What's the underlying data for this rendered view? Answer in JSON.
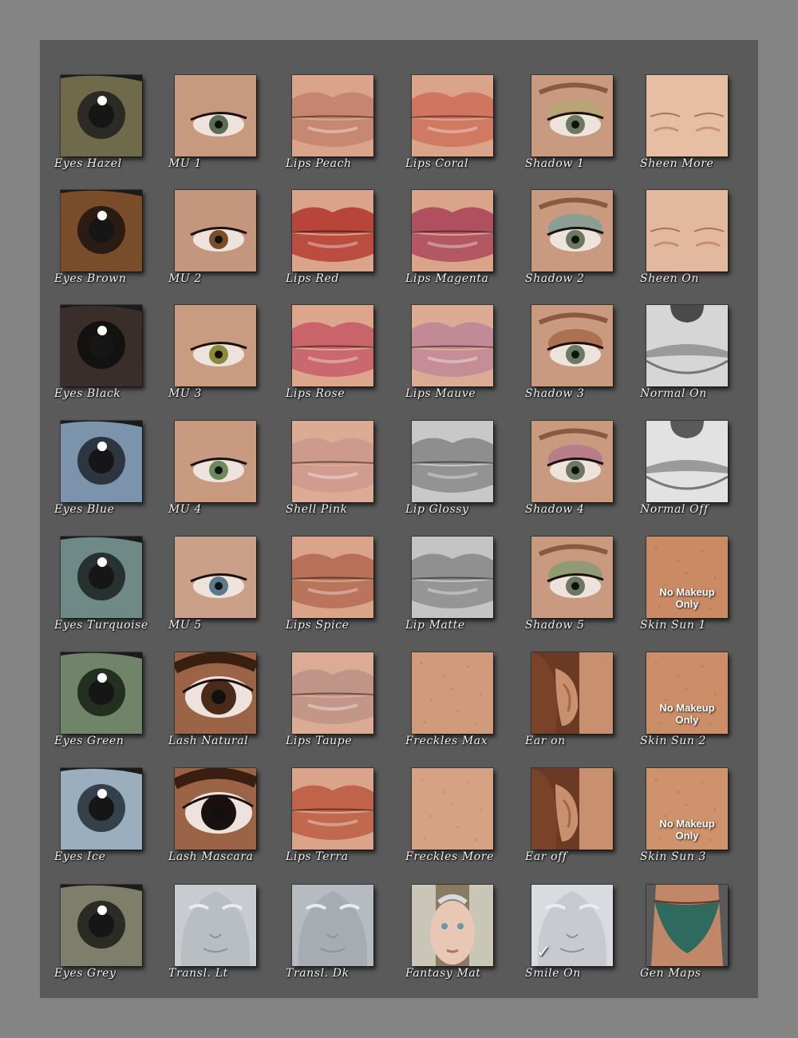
{
  "columns": [
    {
      "id": "eyes",
      "items": [
        {
          "label": "Eyes Hazel",
          "swatch": "eye-hazel",
          "colors": [
            "#6e6a4a",
            "#2b2a25"
          ]
        },
        {
          "label": "Eyes Brown",
          "swatch": "eye-brown",
          "colors": [
            "#7a4e2a",
            "#2a1c12"
          ]
        },
        {
          "label": "Eyes Black",
          "swatch": "eye-black",
          "colors": [
            "#3a2f2a",
            "#141211"
          ]
        },
        {
          "label": "Eyes Blue",
          "swatch": "eye-blue",
          "colors": [
            "#7b93ab",
            "#2c3540"
          ]
        },
        {
          "label": "Eyes Turquoise",
          "swatch": "eye-turquoise",
          "colors": [
            "#6f8a86",
            "#263130"
          ]
        },
        {
          "label": "Eyes Green",
          "swatch": "eye-green",
          "colors": [
            "#6f8468",
            "#24301f"
          ]
        },
        {
          "label": "Eyes Ice",
          "swatch": "eye-ice",
          "colors": [
            "#9aaebd",
            "#34404a"
          ]
        },
        {
          "label": "Eyes Grey",
          "swatch": "eye-grey",
          "colors": [
            "#7e7e6a",
            "#2b2b26"
          ]
        }
      ]
    },
    {
      "id": "makeup",
      "items": [
        {
          "label": "MU 1",
          "swatch": "makeup-eye",
          "colors": [
            "#c79a80",
            "#5a6e55"
          ]
        },
        {
          "label": "MU 2",
          "swatch": "makeup-eye",
          "colors": [
            "#c4967d",
            "#7a4e2a"
          ]
        },
        {
          "label": "MU 3",
          "swatch": "makeup-eye",
          "colors": [
            "#c89c80",
            "#8c8a3a"
          ]
        },
        {
          "label": "MU 4",
          "swatch": "makeup-eye",
          "colors": [
            "#c89a80",
            "#6e8a5a"
          ]
        },
        {
          "label": "MU 5",
          "swatch": "makeup-eye",
          "colors": [
            "#caa088",
            "#5c7a8a"
          ]
        },
        {
          "label": "Lash Natural",
          "swatch": "lash-eye",
          "colors": [
            "#8a5a3c",
            "#4a2a18"
          ]
        },
        {
          "label": "Lash Mascara",
          "swatch": "lash-eye",
          "colors": [
            "#8c5c40",
            "#1a1010"
          ]
        },
        {
          "label": "Transl. Lt",
          "swatch": "face-grey",
          "colors": [
            "#c8ccd0",
            "#9ea3a8"
          ]
        }
      ]
    },
    {
      "id": "lips-a",
      "items": [
        {
          "label": "Lips Peach",
          "swatch": "lips",
          "colors": [
            "#d9a48a",
            "#c58570"
          ]
        },
        {
          "label": "Lips Red",
          "swatch": "lips",
          "colors": [
            "#d9a48a",
            "#b8443a"
          ]
        },
        {
          "label": "Lips Rose",
          "swatch": "lips",
          "colors": [
            "#dca58c",
            "#c8646a"
          ]
        },
        {
          "label": "Shell Pink",
          "swatch": "lips",
          "colors": [
            "#dcab94",
            "#cf9a8e"
          ]
        },
        {
          "label": "Lips Spice",
          "swatch": "lips",
          "colors": [
            "#d9a48a",
            "#b87058"
          ]
        },
        {
          "label": "Lips Taupe",
          "swatch": "lips",
          "colors": [
            "#dcab94",
            "#c09486"
          ]
        },
        {
          "label": "Lips Terra",
          "swatch": "lips",
          "colors": [
            "#d9a48a",
            "#c0634a"
          ]
        },
        {
          "label": "Transl. Dk",
          "swatch": "face-grey",
          "colors": [
            "#b6bbc0",
            "#8d9298"
          ]
        }
      ]
    },
    {
      "id": "lips-b",
      "items": [
        {
          "label": "Lips Coral",
          "swatch": "lips",
          "colors": [
            "#d9a48a",
            "#cf7560"
          ]
        },
        {
          "label": "Lips Magenta",
          "swatch": "lips",
          "colors": [
            "#d9a48a",
            "#b0505e"
          ]
        },
        {
          "label": "Lips Mauve",
          "swatch": "lips",
          "colors": [
            "#dcab94",
            "#c28a96"
          ]
        },
        {
          "label": "Lip Glossy",
          "swatch": "lips-grey",
          "colors": [
            "#c8c8c8",
            "#8e8e8e"
          ]
        },
        {
          "label": "Lip Matte",
          "swatch": "lips-grey",
          "colors": [
            "#c4c4c4",
            "#909090"
          ]
        },
        {
          "label": "Freckles Max",
          "swatch": "skin",
          "colors": [
            "#d19a7a",
            "#b67a5a"
          ]
        },
        {
          "label": "Freckles More",
          "swatch": "skin",
          "colors": [
            "#d6a284",
            "#c08a6c"
          ]
        },
        {
          "label": "Fantasy Mat",
          "swatch": "fantasy-face",
          "colors": [
            "#e8c8b4",
            "#d6dbe0"
          ]
        }
      ]
    },
    {
      "id": "shadow",
      "items": [
        {
          "label": "Shadow 1",
          "swatch": "shadow-eye",
          "colors": [
            "#c99a80",
            "#b0a870"
          ]
        },
        {
          "label": "Shadow 2",
          "swatch": "shadow-eye",
          "colors": [
            "#c99a80",
            "#6fa0a0"
          ]
        },
        {
          "label": "Shadow 3",
          "swatch": "shadow-eye",
          "colors": [
            "#c99a80",
            "#a06040"
          ]
        },
        {
          "label": "Shadow 4",
          "swatch": "shadow-eye",
          "colors": [
            "#c99a80",
            "#b07090"
          ]
        },
        {
          "label": "Shadow 5",
          "swatch": "shadow-eye",
          "colors": [
            "#c99a80",
            "#7a9a70"
          ]
        },
        {
          "label": "Ear on",
          "swatch": "ear",
          "colors": [
            "#c8906e",
            "#6a3a24"
          ]
        },
        {
          "label": "Ear off",
          "swatch": "ear",
          "colors": [
            "#c8906e",
            "#6a3a24"
          ]
        },
        {
          "label": "Smile On",
          "swatch": "face-grey",
          "colors": [
            "#d8dce0",
            "#a8adb2"
          ],
          "check": "✓"
        }
      ]
    },
    {
      "id": "skin",
      "items": [
        {
          "label": "Sheen More",
          "swatch": "face-skin",
          "colors": [
            "#e6bea4",
            "#c89478"
          ]
        },
        {
          "label": "Sheen On",
          "swatch": "face-skin",
          "colors": [
            "#e2b89e",
            "#c49074"
          ]
        },
        {
          "label": "Normal On",
          "swatch": "normal-grey",
          "colors": [
            "#d6d6d6",
            "#4a4a4a"
          ]
        },
        {
          "label": "Normal Off",
          "swatch": "normal-grey",
          "colors": [
            "#e2e2e2",
            "#5a5a5a"
          ]
        },
        {
          "label": "Skin Sun 1",
          "swatch": "skin",
          "colors": [
            "#c98a64",
            "#b07052"
          ],
          "overlay": "No Makeup\nOnly"
        },
        {
          "label": "Skin Sun 2",
          "swatch": "skin",
          "colors": [
            "#cc8e68",
            "#b27456"
          ],
          "overlay": "No Makeup\nOnly"
        },
        {
          "label": "Skin Sun 3",
          "swatch": "skin",
          "colors": [
            "#ce926c",
            "#b4785a"
          ],
          "overlay": "No Makeup\nOnly"
        },
        {
          "label": "Gen Maps",
          "swatch": "gen",
          "colors": [
            "#c08868",
            "#2f6a5e"
          ]
        }
      ]
    }
  ]
}
